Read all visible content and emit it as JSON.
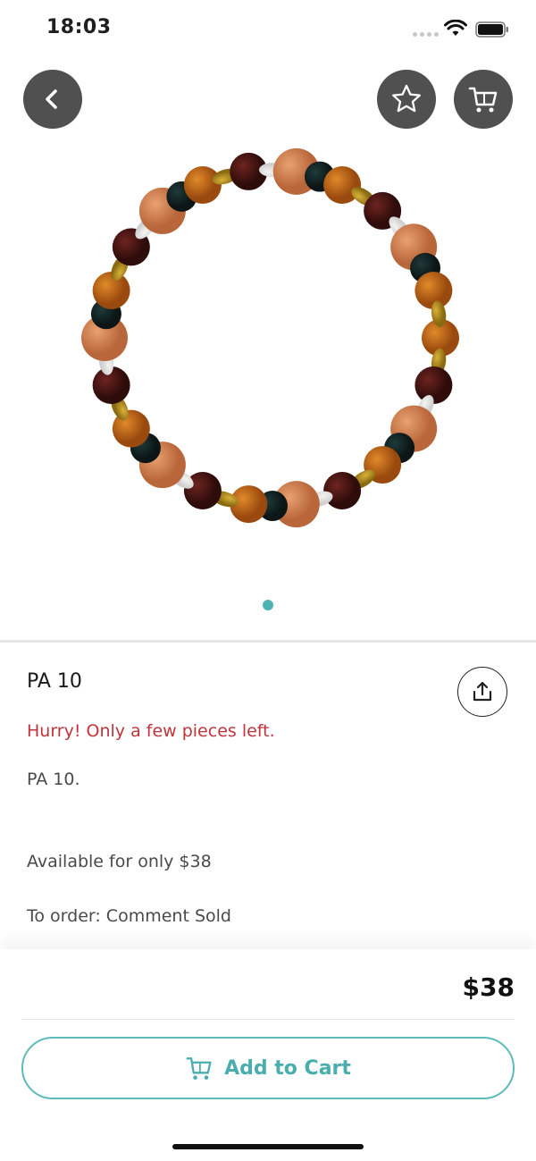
{
  "status_bar": {
    "time": "18:03"
  },
  "icons": {
    "back": "chevron-left-icon",
    "favorite": "star-icon",
    "cart": "cart-icon",
    "share": "share-icon",
    "add_to_cart": "cart-icon"
  },
  "colors": {
    "accent": "#4aaeae",
    "warning": "#c0343c",
    "nav_button": "#505050"
  },
  "carousel": {
    "current": 1,
    "total": 1
  },
  "product": {
    "title": "PA 10",
    "stock_warning": "Hurry! Only a few pieces left.",
    "description_lines": [
      "PA 10.",
      "Available for only $38",
      "To order: Comment Sold"
    ],
    "price": "$38"
  },
  "actions": {
    "add_to_cart_label": "Add to Cart"
  }
}
